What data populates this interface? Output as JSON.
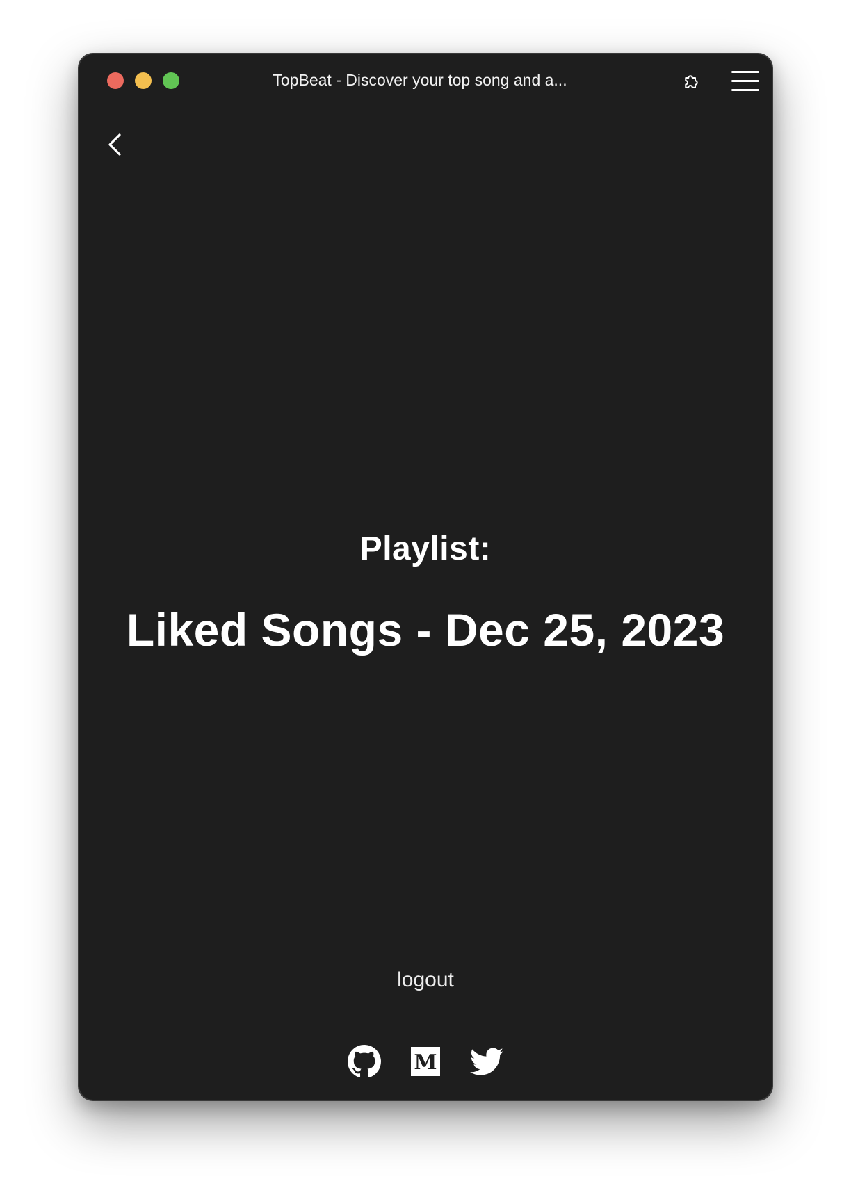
{
  "window": {
    "title": "TopBeat - Discover your top song and a..."
  },
  "content": {
    "heading": "Playlist:",
    "playlist_name": "Liked Songs - Dec 25, 2023",
    "logout_label": "logout"
  },
  "social_links": [
    {
      "name": "github",
      "icon": "github-icon"
    },
    {
      "name": "medium",
      "icon": "medium-icon"
    },
    {
      "name": "twitter",
      "icon": "twitter-icon"
    }
  ],
  "colors": {
    "window_background": "#1e1e1e",
    "text": "#ffffff",
    "traffic_close": "#ec6a5e",
    "traffic_minimize": "#f4bf4f",
    "traffic_maximize": "#61c554"
  }
}
